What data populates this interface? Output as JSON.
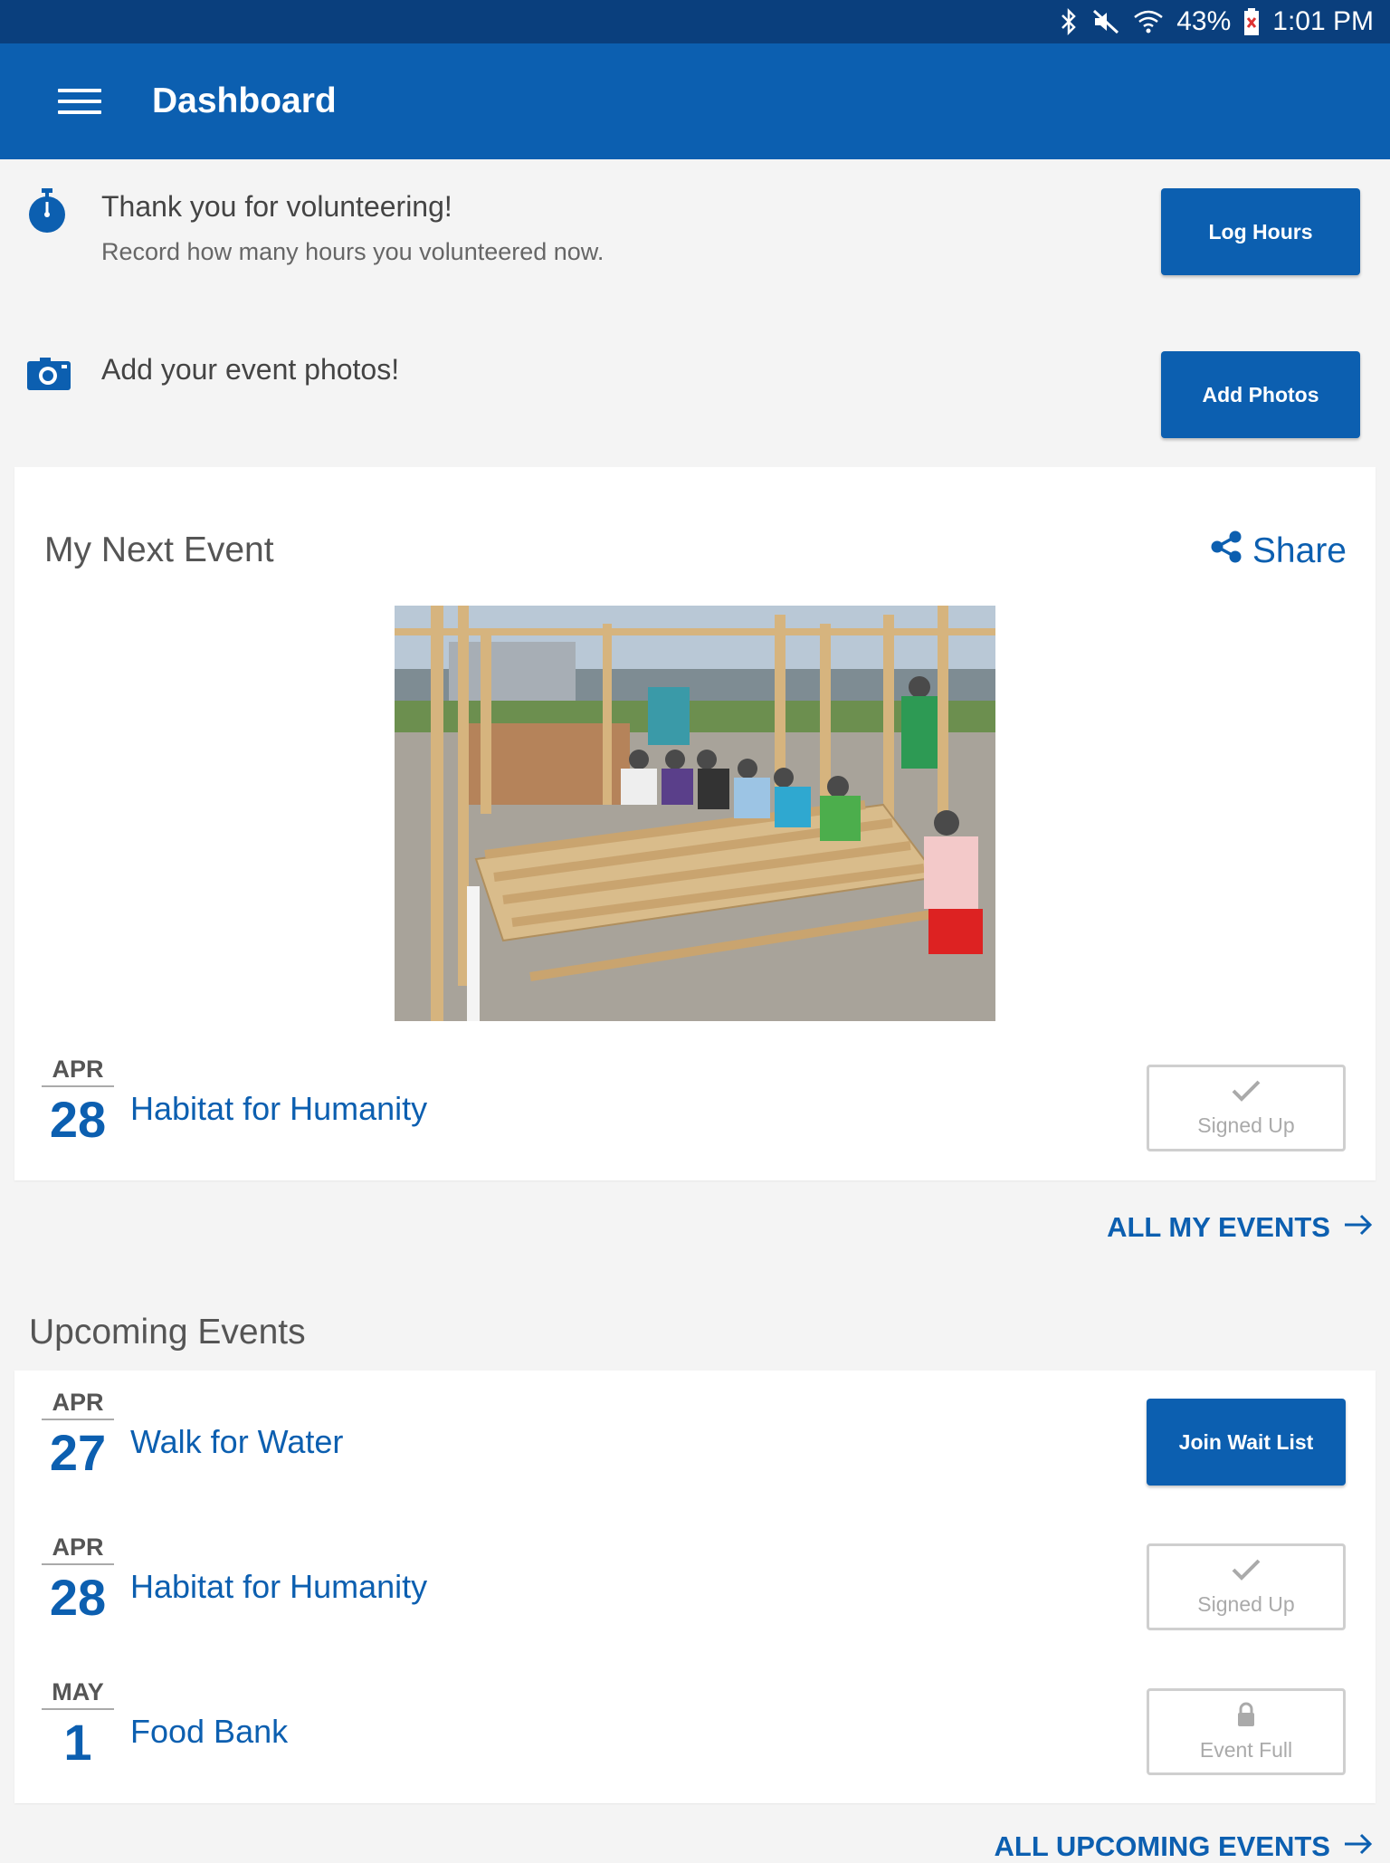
{
  "status_bar": {
    "battery": "43%",
    "time": "1:01 PM",
    "icons": [
      "bluetooth-icon",
      "mute-icon",
      "wifi-icon",
      "battery-icon"
    ]
  },
  "app_bar": {
    "title": "Dashboard",
    "menu_icon": "hamburger-icon"
  },
  "prompts": [
    {
      "icon": "stopwatch-icon",
      "title": "Thank you for volunteering!",
      "subtitle": "Record how many hours you volunteered now.",
      "button": "Log Hours"
    },
    {
      "icon": "camera-icon",
      "title": "Add your event photos!",
      "button": "Add Photos"
    }
  ],
  "next_event": {
    "heading": "My Next Event",
    "share_label": "Share",
    "image_alt": "Volunteers building a house frame",
    "month": "APR",
    "day": "28",
    "name": "Habitat for Humanity",
    "status": "Signed Up",
    "status_icon": "check-icon"
  },
  "all_my_events_link": "ALL MY EVENTS",
  "upcoming": {
    "heading": "Upcoming Events",
    "events": [
      {
        "month": "APR",
        "day": "27",
        "name": "Walk for Water",
        "action": "Join Wait List"
      },
      {
        "month": "APR",
        "day": "28",
        "name": "Habitat for Humanity",
        "action": "Signed Up",
        "action_icon": "check-icon"
      },
      {
        "month": "MAY",
        "day": "1",
        "name": "Food Bank",
        "action": "Event Full",
        "action_icon": "lock-icon"
      }
    ],
    "all_link": "ALL UPCOMING EVENTS"
  },
  "colors": {
    "primary": "#0c5fb0",
    "status_bar": "#0a3f7d",
    "background": "#f4f4f4"
  }
}
